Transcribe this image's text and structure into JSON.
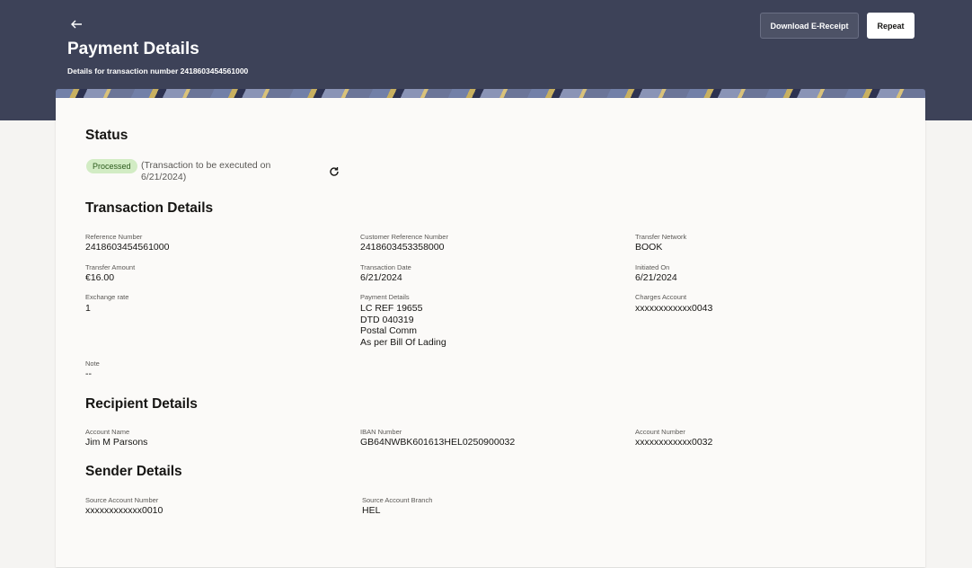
{
  "header": {
    "back_icon": "arrow-left-icon",
    "title": "Payment Details",
    "subtitle": "Details for transaction number 2418603454561000",
    "download_label": "Download E-Receipt",
    "repeat_label": "Repeat"
  },
  "status": {
    "heading": "Status",
    "badge": "Processed",
    "note": "(Transaction to be executed on 6/21/2024)",
    "refresh_icon": "refresh-icon"
  },
  "transaction": {
    "heading": "Transaction Details",
    "reference_number": {
      "label": "Reference Number",
      "value": "2418603454561000"
    },
    "customer_reference_number": {
      "label": "Customer Reference Number",
      "value": "2418603453358000"
    },
    "transfer_network": {
      "label": "Transfer Network",
      "value": "BOOK"
    },
    "transfer_amount": {
      "label": "Transfer Amount",
      "value": "€16.00"
    },
    "transaction_date": {
      "label": "Transaction Date",
      "value": "6/21/2024"
    },
    "initiated_on": {
      "label": "Initiated On",
      "value": "6/21/2024"
    },
    "exchange_rate": {
      "label": "Exchange rate",
      "value": "1"
    },
    "payment_details": {
      "label": "Payment Details",
      "value": "LC REF 19655\nDTD 040319\nPostal Comm\nAs per Bill Of Lading"
    },
    "charges_account": {
      "label": "Charges Account",
      "value": "xxxxxxxxxxxx0043"
    },
    "note": {
      "label": "Note",
      "value": "--"
    }
  },
  "recipient": {
    "heading": "Recipient Details",
    "account_name": {
      "label": "Account Name",
      "value": "Jim M Parsons"
    },
    "iban_number": {
      "label": "IBAN Number",
      "value": "GB64NWBK601613HEL0250900032"
    },
    "account_number": {
      "label": "Account Number",
      "value": "xxxxxxxxxxxx0032"
    }
  },
  "sender": {
    "heading": "Sender Details",
    "source_account_number": {
      "label": "Source Account Number",
      "value": "xxxxxxxxxxxx0010"
    },
    "source_account_branch": {
      "label": "Source Account Branch",
      "value": "HEL"
    }
  }
}
